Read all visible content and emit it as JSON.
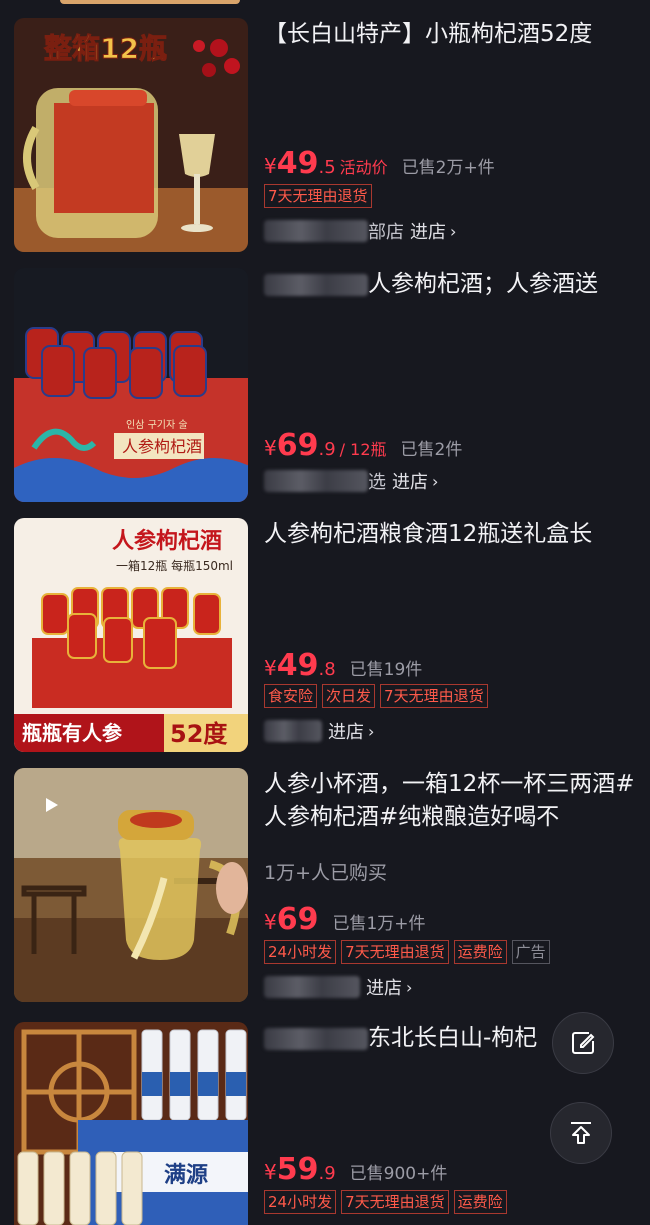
{
  "products": [
    {
      "title": "【长白山特产】小瓶枸杞酒52度",
      "image_banner": "整箱12瓶",
      "price_int": "49",
      "price_dec": ".5",
      "price_tag": "活动价",
      "sold": "已售2万+件",
      "tags": [
        "7天无理由退货"
      ],
      "store_suffix": "部店",
      "store_link": "进店"
    },
    {
      "title_suffix": "人参枸杞酒；人参酒送",
      "image_box_label": "人参枸杞酒",
      "image_box_sub": "인삼 구기자 술",
      "price_int": "69",
      "price_dec": ".9",
      "price_tag": "/ 12瓶",
      "sold": "已售2件",
      "tags": [],
      "store_suffix": "选",
      "store_link": "进店"
    },
    {
      "title": "人参枸杞酒粮食酒12瓶送礼盒长",
      "image_title": "人参枸杞酒",
      "image_sub": "一箱12瓶  每瓶150ml",
      "image_bottom_left": "瓶瓶有人参",
      "image_bottom_right": "52度",
      "price_int": "49",
      "price_dec": ".8",
      "price_tag": "",
      "sold": "已售19件",
      "tags": [
        "食安险",
        "次日发",
        "7天无理由退货"
      ],
      "store_suffix": "",
      "store_link": "进店"
    },
    {
      "title": "人参小杯酒，一箱12杯一杯三两酒#人参枸杞酒#纯粮酿造好喝不",
      "bought": "1万+人已购买",
      "price_int": "69",
      "price_dec": "",
      "price_tag": "",
      "sold": "已售1万+件",
      "tags": [
        "24小时发",
        "7天无理由退货",
        "运费险"
      ],
      "ad_tag": "广告",
      "store_suffix": "",
      "store_link": "进店"
    },
    {
      "title_suffix": "东北长白山-枸杞",
      "image_brand": "满源",
      "price_int": "59",
      "price_dec": ".9",
      "price_tag": "",
      "sold": "已售900+件",
      "tags": [
        "24小时发",
        "7天无理由退货",
        "运费险"
      ]
    }
  ],
  "common": {
    "yen": "¥",
    "chevron": "›"
  },
  "icons": {
    "edit": "edit-icon",
    "top": "back-to-top-icon",
    "play": "play-icon"
  },
  "colors": {
    "price": "#ff3b4e",
    "tag_border": "#a8382f",
    "background": "#17181f"
  }
}
